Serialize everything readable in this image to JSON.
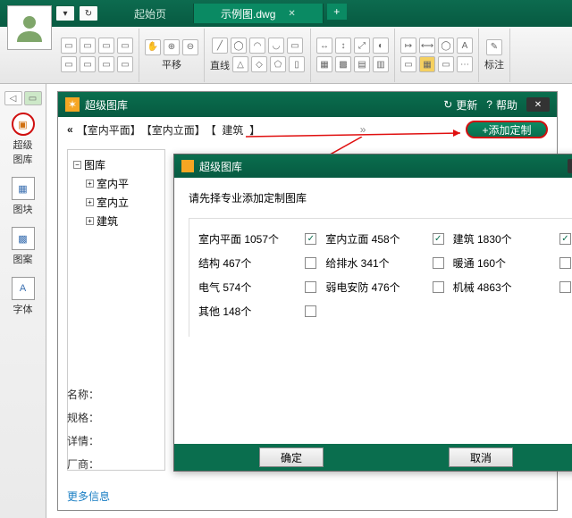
{
  "tabs": {
    "home": "起始页",
    "active": "示例图.dwg"
  },
  "ribbon": {
    "pan": "平移",
    "line": "直线",
    "annot": "标注"
  },
  "sidebar": {
    "super": "超级\n图库",
    "block": "图块",
    "pattern": "图案",
    "font": "字体"
  },
  "panel1": {
    "title": "超级图库",
    "update": "更新",
    "help": "帮助",
    "crumbs": [
      "【室内平面】",
      "【室内立面】",
      "【",
      "建筑",
      "】"
    ],
    "addCustom": "+添加定制"
  },
  "tree": {
    "root": "图库",
    "nodes": [
      "室内平",
      "室内立",
      "建筑"
    ]
  },
  "detail": {
    "name": "名称：",
    "spec": "规格：",
    "info": "详情：",
    "vendor": "厂商：",
    "more": "更多信息"
  },
  "panel2": {
    "title": "超级图库",
    "prompt": "请先择专业添加定制图库",
    "items": [
      [
        {
          "label": "室内平面 1057个",
          "checked": true
        },
        {
          "label": "结构 467个",
          "checked": false
        },
        {
          "label": "电气 574个",
          "checked": false
        },
        {
          "label": "其他 148个",
          "checked": false
        }
      ],
      [
        {
          "label": "室内立面 458个",
          "checked": true
        },
        {
          "label": "给排水 341个",
          "checked": false
        },
        {
          "label": "弱电安防 476个",
          "checked": false
        }
      ],
      [
        {
          "label": "建筑 1830个",
          "checked": true
        },
        {
          "label": "暖通 160个",
          "checked": false
        },
        {
          "label": "机械 4863个",
          "checked": false
        }
      ]
    ],
    "ok": "确定",
    "cancel": "取消"
  }
}
